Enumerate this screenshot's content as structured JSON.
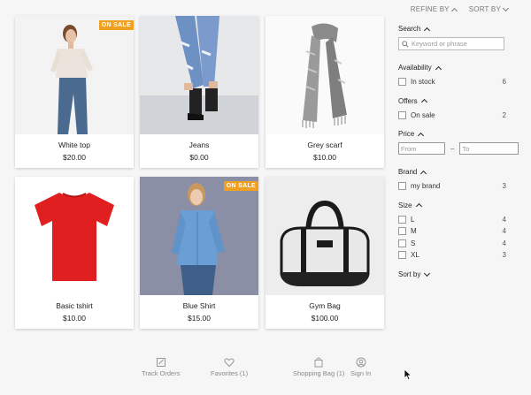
{
  "topbar": {
    "refine_label": "REFINE BY",
    "sort_label": "SORT BY"
  },
  "products": [
    {
      "name": "White top",
      "price": "$20.00",
      "badge": "ON SALE"
    },
    {
      "name": "Jeans",
      "price": "$0.00",
      "badge": ""
    },
    {
      "name": "Grey scarf",
      "price": "$10.00",
      "badge": ""
    },
    {
      "name": "Basic tshirt",
      "price": "$10.00",
      "badge": ""
    },
    {
      "name": "Blue Shirt",
      "price": "$15.00",
      "badge": "ON SALE"
    },
    {
      "name": "Gym Bag",
      "price": "$100.00",
      "badge": ""
    }
  ],
  "filters": {
    "search": {
      "title": "Search",
      "placeholder": "Keyword or phrase"
    },
    "availability": {
      "title": "Availability",
      "items": [
        {
          "label": "In stock",
          "count": "6"
        }
      ]
    },
    "offers": {
      "title": "Offers",
      "items": [
        {
          "label": "On sale",
          "count": "2"
        }
      ]
    },
    "price": {
      "title": "Price",
      "from_placeholder": "From",
      "to_placeholder": "To",
      "separator": "–"
    },
    "brand": {
      "title": "Brand",
      "items": [
        {
          "label": "my brand",
          "count": "3"
        }
      ]
    },
    "size": {
      "title": "Size",
      "items": [
        {
          "label": "L",
          "count": "4"
        },
        {
          "label": "M",
          "count": "4"
        },
        {
          "label": "S",
          "count": "4"
        },
        {
          "label": "XL",
          "count": "3"
        }
      ]
    },
    "sort": {
      "title": "Sort by"
    }
  },
  "bottom_nav": [
    {
      "label": "Track Orders",
      "icon": "track-orders-icon"
    },
    {
      "label": "Favorites (1)",
      "icon": "heart-icon"
    },
    {
      "label": "Shopping Bag (1)",
      "icon": "shopping-bag-icon"
    },
    {
      "label": "Sign In",
      "icon": "user-icon"
    }
  ],
  "colors": {
    "badge": "#f0a020",
    "background": "#f6f6f7",
    "tshirt": "#e02020"
  }
}
